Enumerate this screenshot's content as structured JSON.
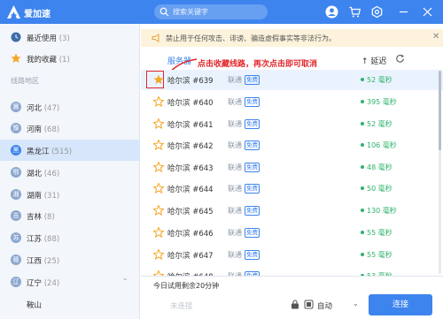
{
  "app": {
    "name": "爱加速",
    "brand_color": "#3d84ee"
  },
  "search": {
    "placeholder": "搜索关键字"
  },
  "titlebar_icons": [
    "avatar-icon",
    "cart-icon",
    "settings-icon",
    "minimize-icon",
    "close-icon"
  ],
  "sidebar": {
    "recent": {
      "label": "最近使用",
      "count": "(3)"
    },
    "favorites": {
      "label": "我的收藏",
      "count": "(1)"
    },
    "section_label": "线路地区",
    "regions": [
      {
        "icon": "冀",
        "label": "河北",
        "count": "(47)"
      },
      {
        "icon": "豫",
        "label": "河南",
        "count": "(68)"
      },
      {
        "icon": "黑",
        "label": "黑龙江",
        "count": "(515)",
        "active": true
      },
      {
        "icon": "鄂",
        "label": "湖北",
        "count": "(46)"
      },
      {
        "icon": "湘",
        "label": "湖南",
        "count": "(31)"
      },
      {
        "icon": "吉",
        "label": "吉林",
        "count": "(8)"
      },
      {
        "icon": "苏",
        "label": "江苏",
        "count": "(88)"
      },
      {
        "icon": "赣",
        "label": "江西",
        "count": "(25)"
      },
      {
        "icon": "辽",
        "label": "辽宁",
        "count": "(24)",
        "expanded": true
      }
    ],
    "sub_item": "鞍山"
  },
  "notice": {
    "text": "禁止用于任何攻击、诽谤、骗造虚假事实等非法行为。"
  },
  "table": {
    "col_server": "服务器",
    "col_latency": "延迟",
    "annotation": "点击收藏线路，再次点击即可取消",
    "rows": [
      {
        "name": "哈尔滨 #639",
        "isp": "联通",
        "badge": "免费",
        "latency": "52 毫秒",
        "starred": true
      },
      {
        "name": "哈尔滨 #640",
        "isp": "联通",
        "badge": "免费",
        "latency": "395 毫秒"
      },
      {
        "name": "哈尔滨 #641",
        "isp": "联通",
        "badge": "免费",
        "latency": "52 毫秒"
      },
      {
        "name": "哈尔滨 #642",
        "isp": "联通",
        "badge": "免费",
        "latency": "106 毫秒"
      },
      {
        "name": "哈尔滨 #643",
        "isp": "联通",
        "badge": "免费",
        "latency": "48 毫秒"
      },
      {
        "name": "哈尔滨 #644",
        "isp": "联通",
        "badge": "免费",
        "latency": "50 毫秒"
      },
      {
        "name": "哈尔滨 #645",
        "isp": "联通",
        "badge": "免费",
        "latency": "130 毫秒"
      },
      {
        "name": "哈尔滨 #646",
        "isp": "联通",
        "badge": "免费",
        "latency": "55 毫秒"
      },
      {
        "name": "哈尔滨 #647",
        "isp": "联通",
        "badge": "免费",
        "latency": "55 毫秒"
      },
      {
        "name": "哈尔滨 #648",
        "isp": "联通",
        "badge": "免费",
        "latency": "53 毫秒"
      }
    ]
  },
  "footer": {
    "trial_text": "今日试用剩余20分钟",
    "disconnect_label": "未连接",
    "mode_label": "自动",
    "connect_label": "连接"
  },
  "colors": {
    "latency_good": "#2db36b",
    "annotation_red": "#e2262a",
    "notice_bg": "#fdf3dc",
    "star": "#f5a623"
  }
}
